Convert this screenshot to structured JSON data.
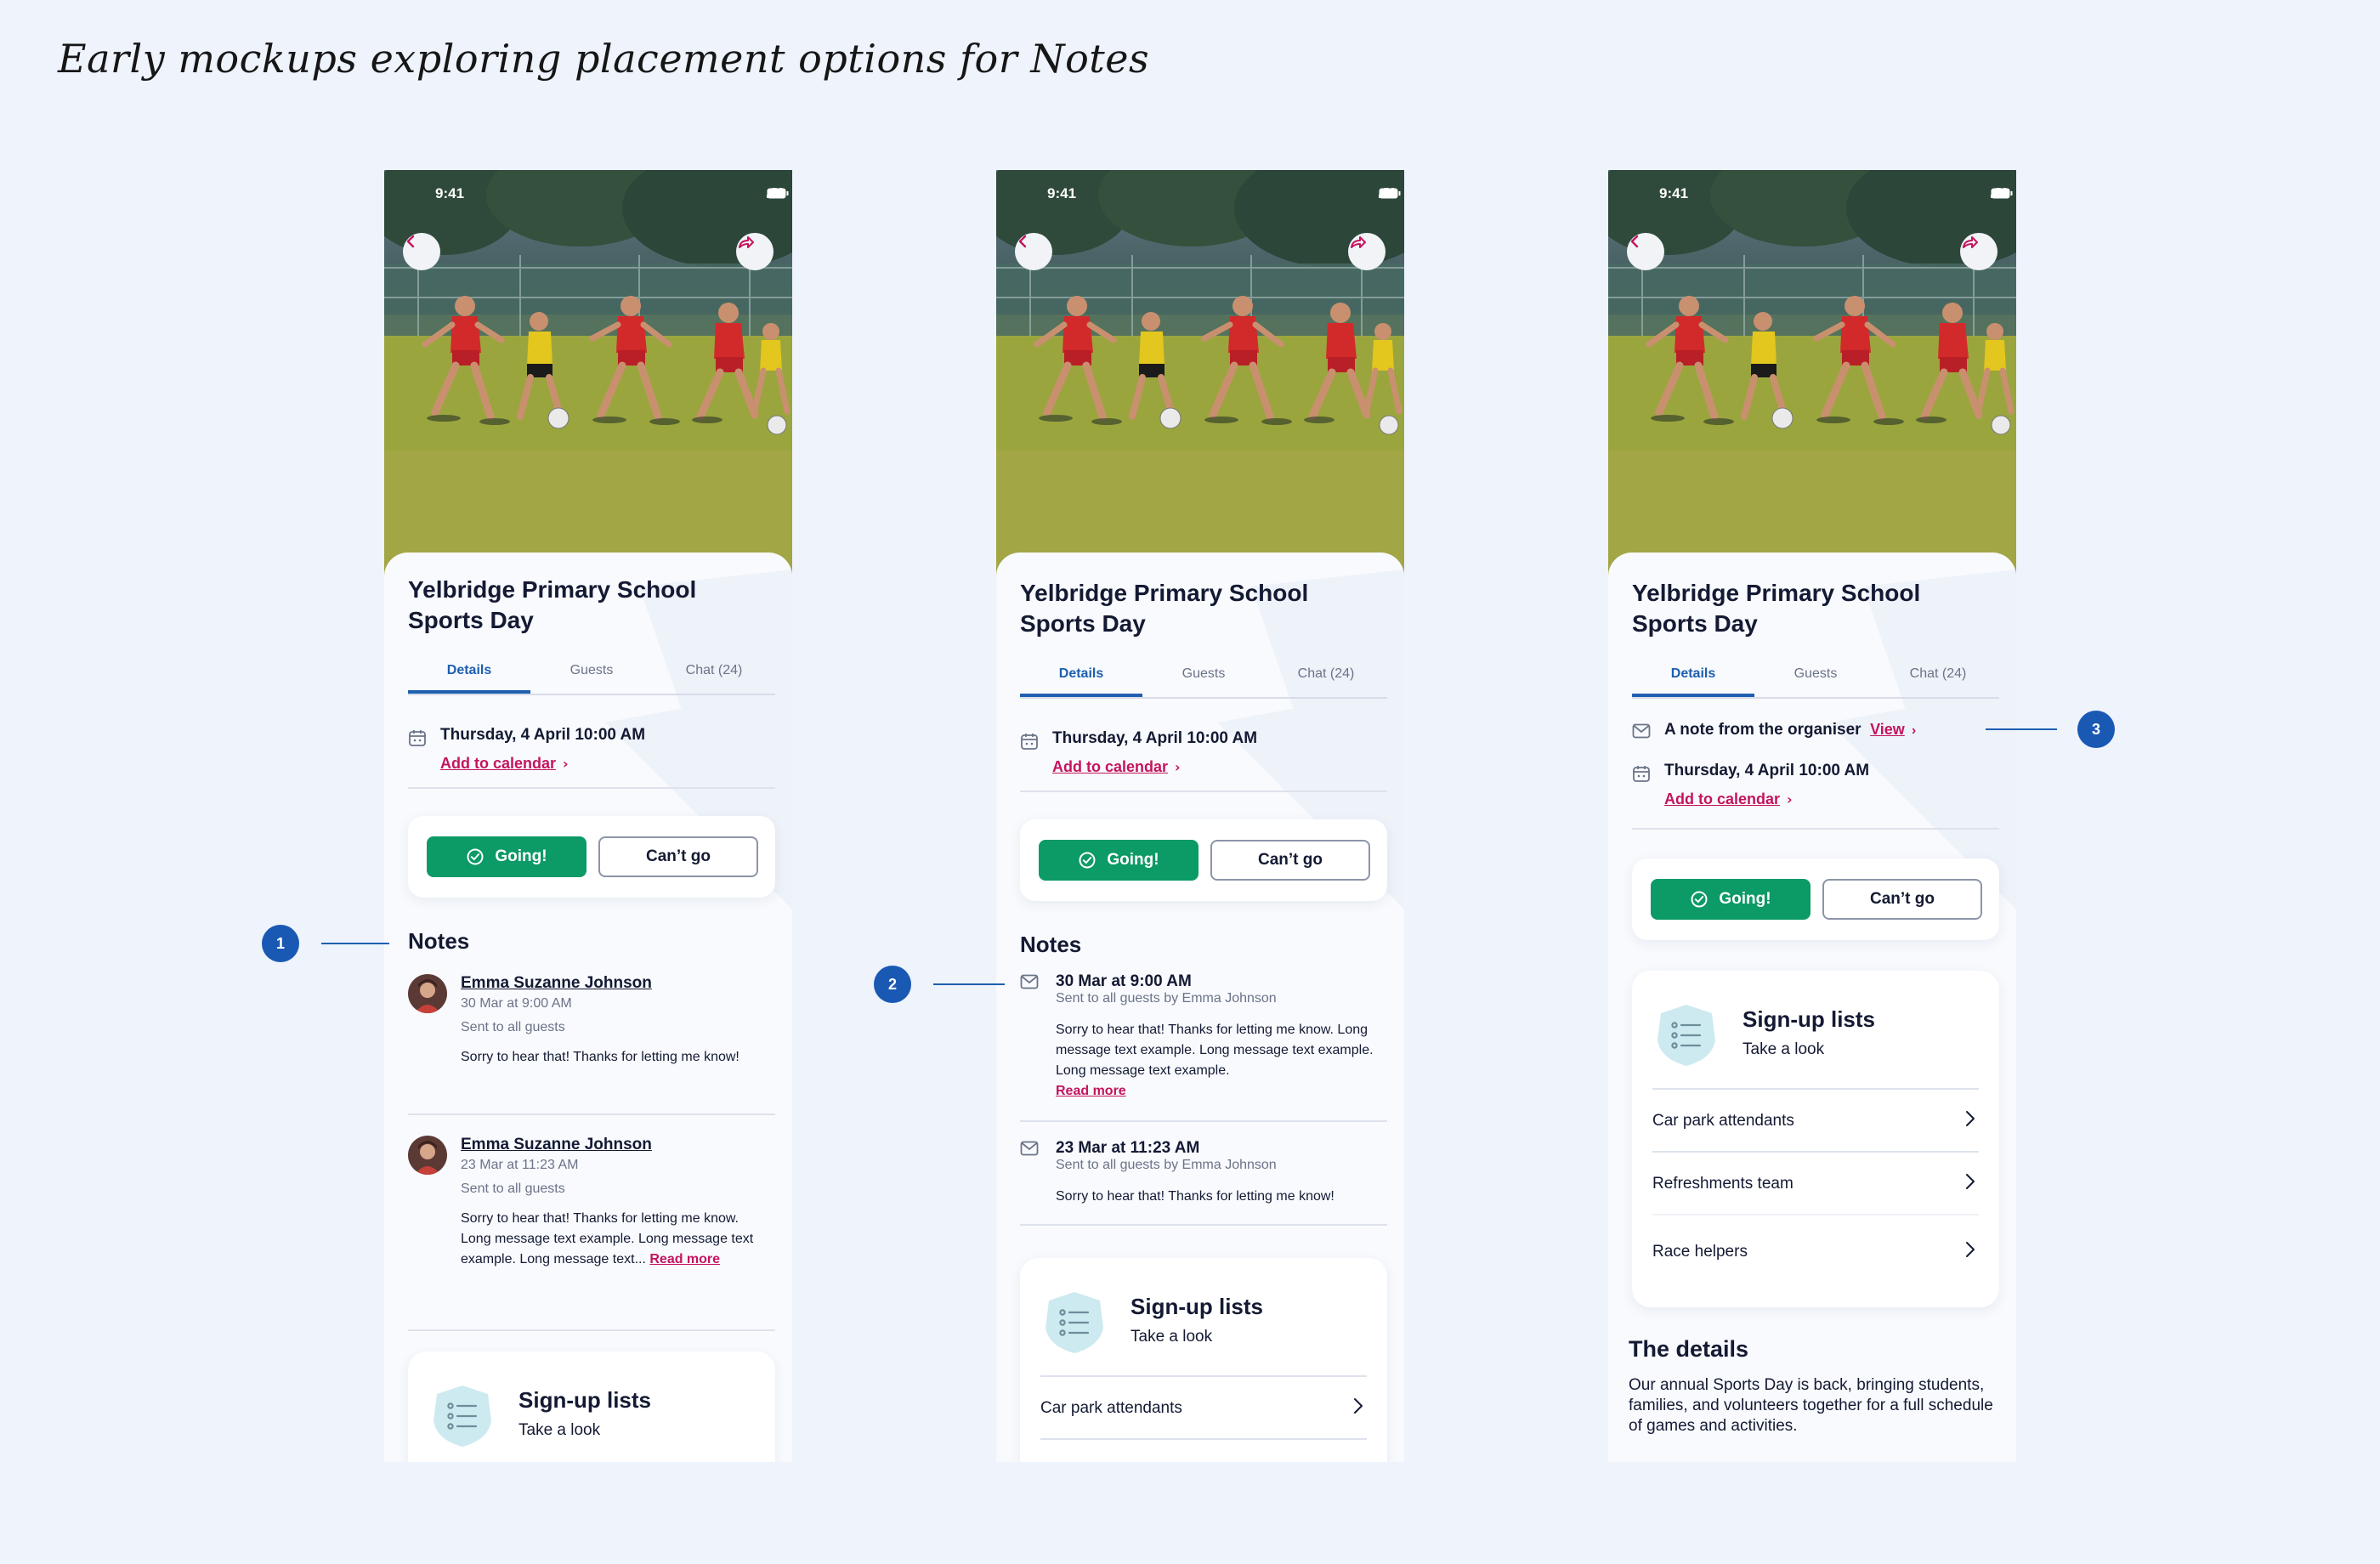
{
  "headline": "Early mockups exploring placement options for Notes",
  "status": {
    "time": "9:41"
  },
  "event": {
    "title_line1": "Yelbridge Primary School",
    "title_line2": "Sports Day",
    "tabs": [
      "Details",
      "Guests",
      "Chat (24)"
    ],
    "date": "Thursday, 4 April 10:00 AM",
    "add_to_calendar": "Add to calendar"
  },
  "rsvp": {
    "going": "Going!",
    "cant_go": "Can’t go"
  },
  "notes": {
    "heading": "Notes",
    "read_more": "Read more",
    "option1": [
      {
        "name": "Emma Suzanne Johnson",
        "time": "30 Mar at 9:00 AM",
        "audience": "Sent to all guests",
        "message": "Sorry to hear that! Thanks for letting me know!"
      },
      {
        "name": "Emma Suzanne Johnson",
        "time": "23 Mar at 11:23 AM",
        "audience": "Sent to all guests",
        "message": "Sorry to hear that! Thanks for letting me know. Long message text example. Long message text example. Long message text..."
      }
    ],
    "option2": [
      {
        "time": "30 Mar at 9:00 AM",
        "sent": "Sent to all guests by Emma Johnson",
        "message": "Sorry to hear that! Thanks for letting me know. Long message text example. Long message text example. Long message text example."
      },
      {
        "time": "23 Mar at 11:23 AM",
        "sent": "Sent to all guests by Emma Johnson",
        "message": "Sorry to hear that! Thanks for letting me know!"
      }
    ],
    "option3": {
      "label": "A note from the organiser",
      "link": "View"
    }
  },
  "signup": {
    "title": "Sign-up lists",
    "subtitle": "Take a look",
    "items": [
      "Car park attendants",
      "Refreshments team",
      "Race helpers"
    ]
  },
  "details": {
    "heading": "The details",
    "body": "Our annual Sports Day is back, bringing students, families, and volunteers together for a full schedule of games and activities."
  },
  "callouts": [
    "1",
    "2",
    "3"
  ],
  "colors": {
    "accent": "#1e5fb0",
    "primary_green": "#0c9a67",
    "link_pink": "#c4145e",
    "callout_blue": "#1959b3"
  }
}
